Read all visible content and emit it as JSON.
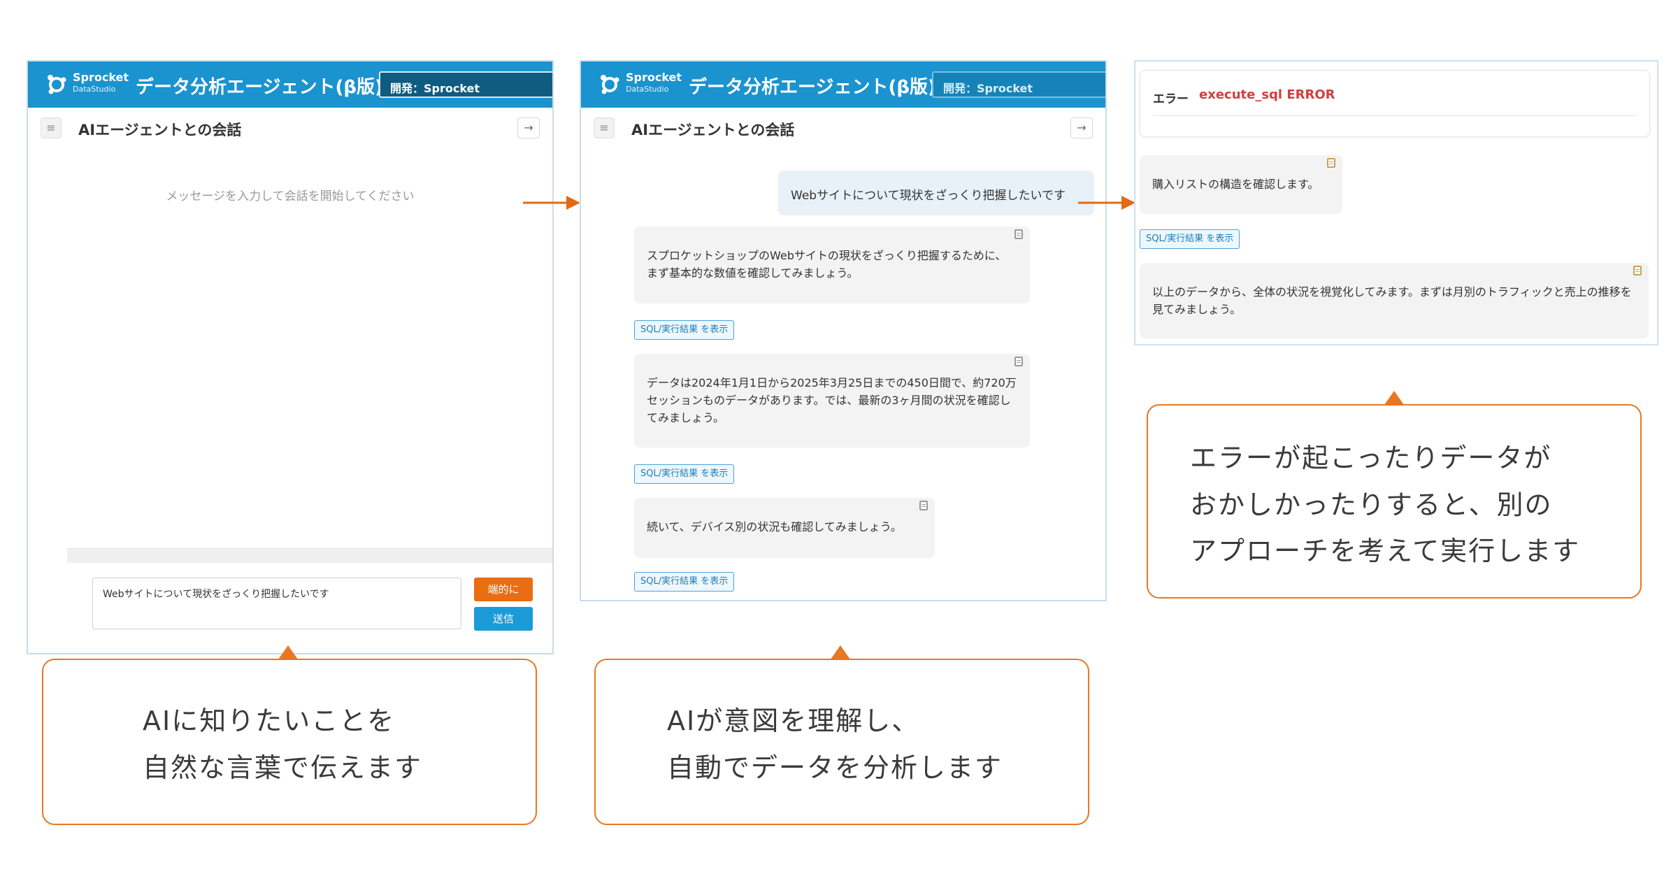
{
  "app": {
    "logo_line1": "Sprocket",
    "logo_line2": "DataStudio",
    "title": "データ分析エージェント(β版)",
    "env": "開発：Sprocket",
    "conversation_title": "AIエージェントとの会話"
  },
  "panel1": {
    "placeholder": "メッセージを入力して会話を開始してください",
    "input_value": "Webサイトについて現状をざっくり把握したいです",
    "concise_button": "端的に",
    "send_button": "送信"
  },
  "panel2": {
    "user_message": "Webサイトについて現状をざっくり把握したいです",
    "messages": [
      {
        "text": "スプロケットショップのWebサイトの現状をざっくり把握するために、まず基本的な数値を確認してみましょう。"
      },
      {
        "text": "データは2024年1月1日から2025年3月25日までの450日間で、約720万セッションものデータがあります。では、最新の3ヶ月間の状況を確認してみましょう。"
      },
      {
        "text": "続いて、デバイス別の状況も確認してみましょう。"
      }
    ],
    "sql_button": "SQL/実行結果 を表示"
  },
  "panel3": {
    "error_label": "エラー",
    "error_value": "execute_sql ERROR",
    "messages": [
      {
        "text": "購入リストの構造を確認します。"
      },
      {
        "text": "以上のデータから、全体の状況を視覚化してみます。まずは月別のトラフィックと売上の推移を見てみましょう。"
      }
    ],
    "sql_button": "SQL/実行結果 を表示"
  },
  "callouts": [
    {
      "lines": [
        "AIに知りたいことを",
        "自然な言葉で伝えます"
      ]
    },
    {
      "lines": [
        "AIが意図を理解し、",
        "自動でデータを分析します"
      ]
    },
    {
      "lines": [
        "エラーが起こったりデータが",
        "おかしかったりすると、別の",
        "アプローチを考えて実行します"
      ]
    }
  ],
  "colors": {
    "header_blue": "#1b93cf",
    "accent_orange": "#e87722",
    "error_red": "#d43d3d",
    "send_blue": "#1a9bd7",
    "concise_orange": "#ea6d14"
  }
}
